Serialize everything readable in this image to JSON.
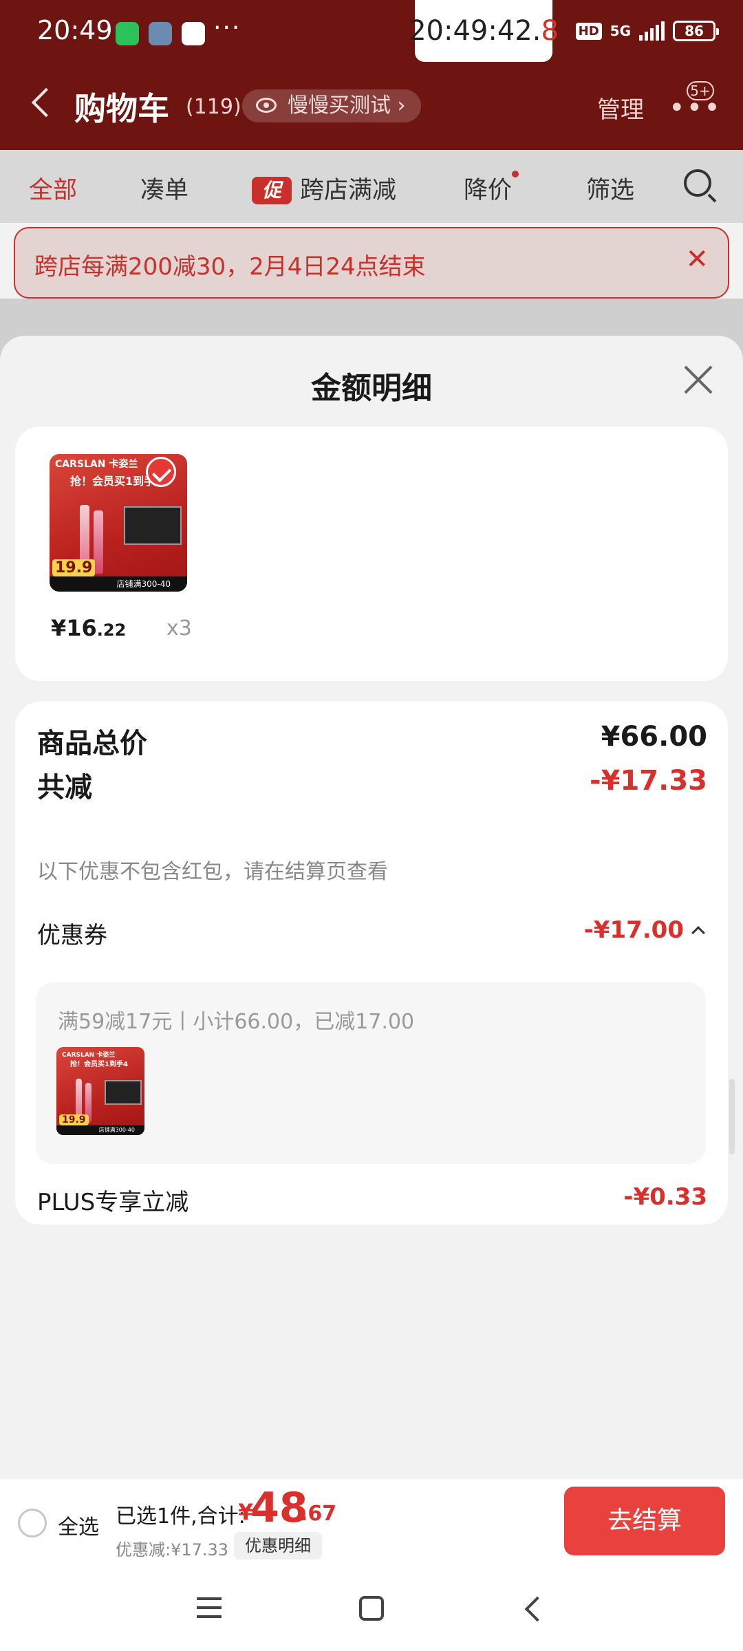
{
  "status_bar": {
    "time": "20:49",
    "more": "···",
    "clock_main": "20:49:42.",
    "clock_tenth": "8",
    "hd": "HD",
    "network": "5G",
    "battery": "86"
  },
  "header": {
    "title": "购物车",
    "count": "(119)",
    "slow_buy": "慢慢买测试 ›",
    "manage": "管理",
    "more": "•••",
    "more_badge": "5+"
  },
  "tabs": [
    {
      "label": "全部",
      "active": true
    },
    {
      "label": "凑单"
    },
    {
      "label": "跨店满减",
      "tag": "促"
    },
    {
      "label": "降价"
    },
    {
      "label": "筛选"
    }
  ],
  "promo_banner": {
    "text": "跨店每满200减30，2月4日24点结束",
    "close": "✕"
  },
  "sheet": {
    "title": "金额明细",
    "product": {
      "thumb_brand": "CARSLAN 卡姿兰",
      "thumb_headline": "抢！会员买1到手4",
      "thumb_price": "19.9",
      "thumb_strip": "店铺满300-40",
      "price_main": "¥16",
      "price_dec": ".22",
      "qty": "x3"
    },
    "summary": {
      "total_label": "商品总价",
      "total_value": "¥66.00",
      "discount_label": "共减",
      "discount_value": "-¥17.33",
      "note": "以下优惠不包含红包，请在结算页查看",
      "coupon_label": "优惠券",
      "coupon_value": "-¥17.00",
      "coupon_desc": "满59减17元丨小计66.00，已减17.00",
      "plus_label": "PLUS专享立减",
      "plus_value": "-¥0.33"
    }
  },
  "bottom_bar": {
    "select_all": "全选",
    "selected_text": "已选1件,合计:",
    "total_yen": "¥",
    "total_int": "48",
    "total_dec": ".67",
    "saved_text": "优惠减:¥17.33",
    "detail_chip": "优惠明细",
    "checkout": "去结算"
  },
  "colors": {
    "header_bg": "#6e1512",
    "accent_red": "#d9302c",
    "checkout_btn": "#e8413e"
  }
}
